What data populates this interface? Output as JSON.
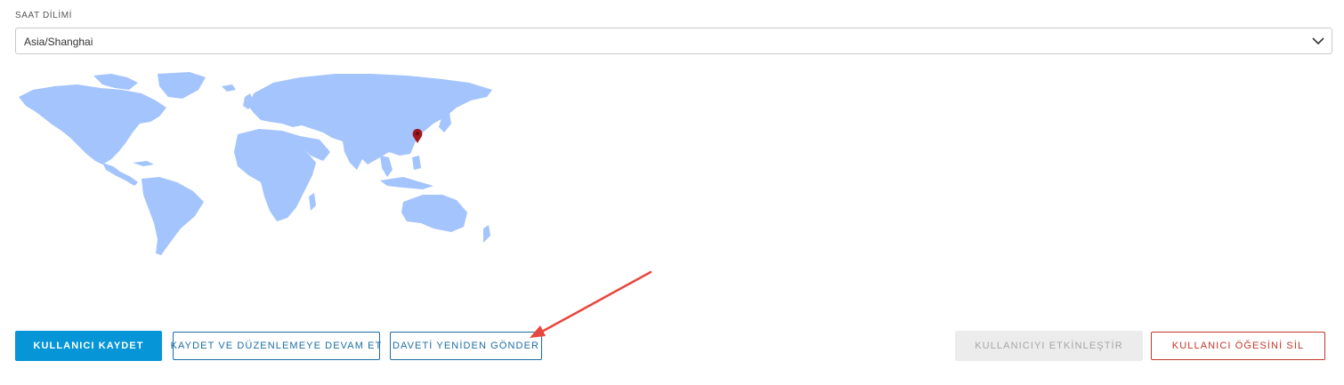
{
  "timezone": {
    "label": "SAAT DİLİMİ",
    "selected": "Asia/Shanghai",
    "icon": "chevron-down-icon"
  },
  "map": {
    "icon": "map-pin-icon",
    "land_color": "#a3c4fd",
    "pin_color": "#a0171d"
  },
  "actions": {
    "save_user": "KULLANICI KAYDET",
    "save_continue": "KAYDET VE DÜZENLEMEYE DEVAM ET",
    "resend_invite": "DAVETİ YENİDEN GÖNDER",
    "activate_user": "KULLANICIYI ETKİNLEŞTİR",
    "delete_user": "KULLANICI ÖĞESİNİ SİL"
  },
  "colors": {
    "primary": "#0696d7",
    "outline": "#1c6ea4",
    "danger": "#c0392b",
    "annotation": "#e8463e"
  }
}
